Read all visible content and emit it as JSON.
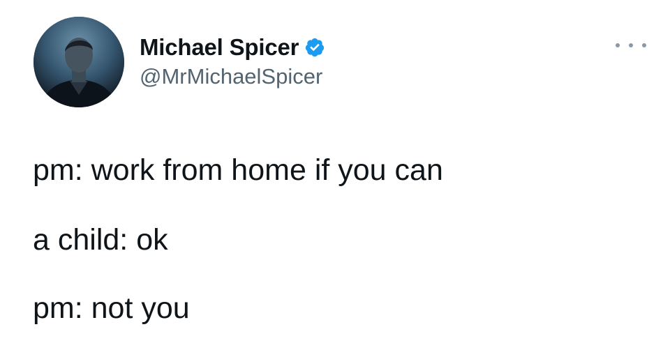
{
  "user": {
    "display_name": "Michael Spicer",
    "handle": "@MrMichaelSpicer",
    "verified": true,
    "verified_icon": "verified-badge-icon",
    "verified_color": "#1d9bf0"
  },
  "menu": {
    "more_icon": "more-horizontal-icon"
  },
  "tweet": {
    "lines": [
      "pm: work from home if you can",
      "a child: ok",
      "pm: not you"
    ]
  }
}
